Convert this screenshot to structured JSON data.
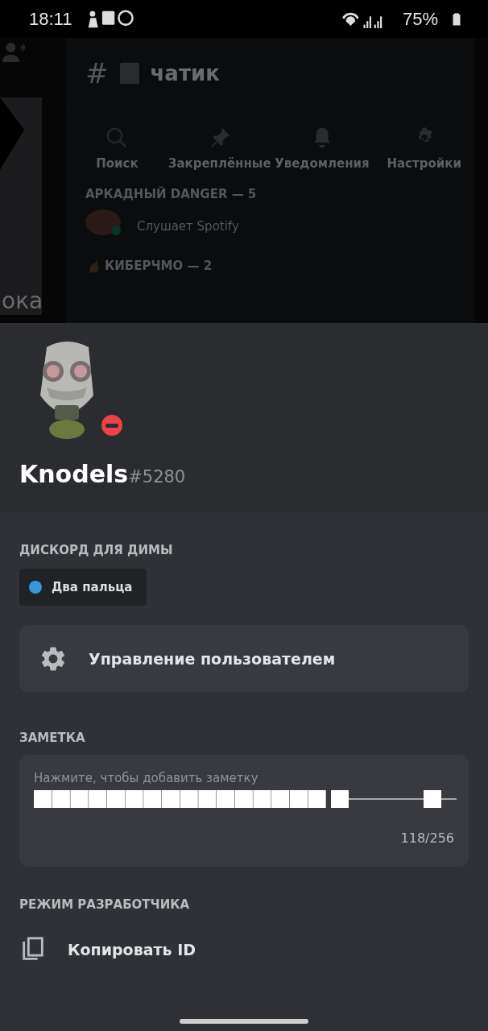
{
  "status_bar": {
    "time": "18:11",
    "battery": "75%"
  },
  "background": {
    "left_fragment": "ока",
    "channel_hash": "#",
    "channel_title": "чатик",
    "actions": [
      {
        "label": "Поиск",
        "kind": "search"
      },
      {
        "label": "Закреплённые",
        "kind": "pin"
      },
      {
        "label": "Уведомления",
        "kind": "bell"
      },
      {
        "label": "Настройки",
        "kind": "gear"
      }
    ],
    "sections": [
      {
        "title": "АРКАДНЫЙ DANGER — 5",
        "member_activity": "Слушает Spotify"
      },
      {
        "title": "КИБЕРЧМО — 2"
      }
    ]
  },
  "profile": {
    "username": "Knodels",
    "discriminator": "#5280"
  },
  "server": {
    "title": "ДИСКОРД ДЛЯ ДИМЫ",
    "roles": [
      {
        "name": "Два пальца",
        "color": "#3498db"
      }
    ]
  },
  "manage_button": "Управление пользователем",
  "note": {
    "title": "ЗАМЕТКА",
    "hint": "Нажмите, чтобы добавить заметку",
    "counter": "118/256"
  },
  "developer": {
    "title": "РЕЖИМ РАЗРАБОТЧИКА",
    "action": "Копировать ID"
  }
}
